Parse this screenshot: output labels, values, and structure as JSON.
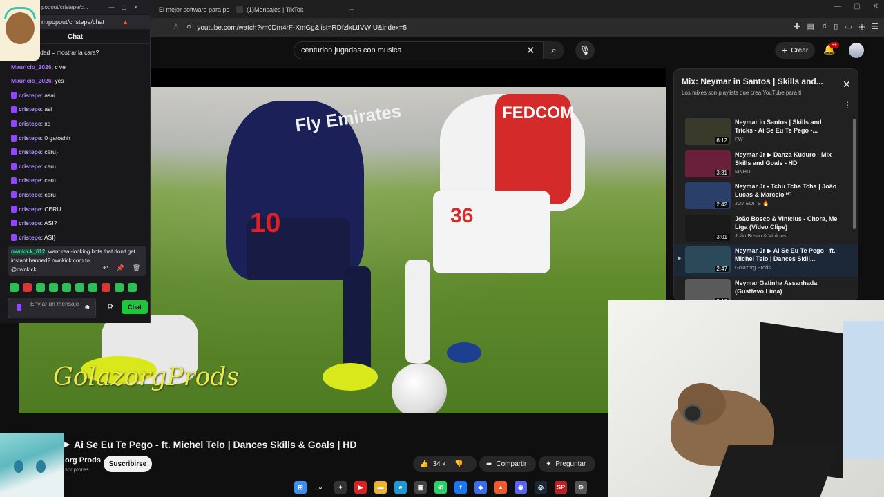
{
  "browser": {
    "tabs": [
      {
        "label": "El mejor software para po"
      },
      {
        "label": "(1)Mensajes | TikTok"
      }
    ],
    "new_tab": "+",
    "url": "youtube.com/watch?v=0Dm4rF-XmGg&list=RDfzlxLtIVWIU&index=5"
  },
  "chat_window": {
    "tab_label": "popout/cristepe/c...",
    "url": "m/popout/cristepe/chat",
    "header": "Chat",
    "messages": [
      {
        "user": "2026",
        "text": ": variedad = mostrar la cara?",
        "color": "purple",
        "badge": false
      },
      {
        "user": "Mauricio_2026",
        "text": ": c ve",
        "color": "purple",
        "badge": false
      },
      {
        "user": "Mauricio_2026",
        "text": ": yes",
        "color": "purple",
        "badge": false
      },
      {
        "user": "cristepe",
        "text": ": asai",
        "color": "mod",
        "badge": true
      },
      {
        "user": "cristepe",
        "text": ": asi",
        "color": "mod",
        "badge": true
      },
      {
        "user": "cristepe",
        "text": ": xd",
        "color": "mod",
        "badge": true
      },
      {
        "user": "cristepe",
        "text": ": 0 gatoshh",
        "color": "mod",
        "badge": true
      },
      {
        "user": "cristepe",
        "text": ": ceru}",
        "color": "mod",
        "badge": true
      },
      {
        "user": "cristepe",
        "text": ": ceru",
        "color": "mod",
        "badge": true
      },
      {
        "user": "cristepe",
        "text": ": ceru",
        "color": "mod",
        "badge": true
      },
      {
        "user": "cristepe",
        "text": ": ceru",
        "color": "mod",
        "badge": true
      },
      {
        "user": "cristepe",
        "text": ": CERU",
        "color": "mod",
        "badge": true
      },
      {
        "user": "cristepe",
        "text": ": ASI?",
        "color": "mod",
        "badge": true
      },
      {
        "user": "cristepe",
        "text": ": ASI}",
        "color": "mod",
        "badge": true
      }
    ],
    "bot_message": {
      "user": "ownkick_612",
      "text": ": want real-looking bots that don't get instant banned? ownkick com to",
      "tail": "@ownkick"
    },
    "input_placeholder": "Enviar un mensaje",
    "send_label": "Chat"
  },
  "youtube": {
    "search_value": "centurion jugadas con musica",
    "create_label": "Crear",
    "notification_count": "9+",
    "video": {
      "title": "Ai Se Eu Te Pego - ft. Michel Telo | Dances Skills & Goals | HD",
      "watermark": "GolazorgProds",
      "jersey_sponsor": "Fly Emirates",
      "jersey_left_number": "10",
      "opponent_sponsor": "FEDCOM",
      "opponent_number": "36"
    },
    "channel": {
      "name": "org Prods",
      "subscribers": "scriptores",
      "subscribe_label": "Suscribirse"
    },
    "actions": {
      "likes": "34 k",
      "share": "Compartir",
      "ask": "Preguntar"
    },
    "playlist": {
      "title": "Mix: Neymar in Santos | Skills and...",
      "subtitle": "Los mixes son playlists que crea YouTube para ti",
      "items": [
        {
          "title": "Neymar in Santos | Skills and Tricks - Ai Se Eu Te Pego -...",
          "channel": "FW",
          "duration": "6:12",
          "active": false,
          "thumb_color": "#3a3a2a"
        },
        {
          "title": "Neymar Jr ▶ Danza Kuduro - Mix Skills and Goals - HD",
          "channel": "MNHD",
          "duration": "3:31",
          "active": false,
          "thumb_color": "#6a1f3a"
        },
        {
          "title": "Neymar Jr • Tchu Tcha Tcha | João Lucas & Marcelo ᴴᴰ",
          "channel": "JO7 EDITS 🔥",
          "duration": "2:42",
          "active": false,
          "thumb_color": "#2a3f6a"
        },
        {
          "title": "João Bosco & Vinícius - Chora, Me Liga (Vídeo Clipe)",
          "channel": "João Bosco & Vinícius",
          "duration": "3:01",
          "active": false,
          "thumb_color": "#1a1a1a"
        },
        {
          "title": "Neymar Jr ▶ Ai Se Eu Te Pego - ft. Michel Telo | Dances Skill...",
          "channel": "Golazorg Prods",
          "duration": "2:47",
          "active": true,
          "thumb_color": "#2a4a5a"
        },
        {
          "title": "Neymar Gatinha Assanhada (Gusttavo Lima)",
          "channel": "",
          "duration": "3:16",
          "active": false,
          "thumb_color": "#5a5a5a"
        }
      ]
    }
  },
  "taskbar": {
    "icons": [
      {
        "name": "windows-start-icon",
        "glyph": "⊞",
        "color": "#3c8ef0"
      },
      {
        "name": "search-icon",
        "glyph": "⌕",
        "color": "transparent"
      },
      {
        "name": "ninja-app-icon",
        "glyph": "✦",
        "color": "#333333"
      },
      {
        "name": "youtube-icon",
        "glyph": "▶",
        "color": "#e02020"
      },
      {
        "name": "file-explorer-icon",
        "glyph": "▬",
        "color": "#e8b530"
      },
      {
        "name": "edge-icon",
        "glyph": "e",
        "color": "#1a9ad6"
      },
      {
        "name": "store-icon",
        "glyph": "▣",
        "color": "#444444"
      },
      {
        "name": "whatsapp-icon",
        "glyph": "✆",
        "color": "#25d366"
      },
      {
        "name": "facebook-icon",
        "glyph": "f",
        "color": "#1877f2"
      },
      {
        "name": "app-blue-icon",
        "glyph": "◆",
        "color": "#3a6df0"
      },
      {
        "name": "brave-icon",
        "glyph": "▲",
        "color": "#f05a28"
      },
      {
        "name": "discord-icon",
        "glyph": "◉",
        "color": "#5865f2"
      },
      {
        "name": "steam-icon",
        "glyph": "◎",
        "color": "#1b2838"
      },
      {
        "name": "sp-app-icon",
        "glyph": "SP",
        "color": "#c02020"
      },
      {
        "name": "settings-icon",
        "glyph": "⚙",
        "color": "#555555"
      }
    ]
  }
}
